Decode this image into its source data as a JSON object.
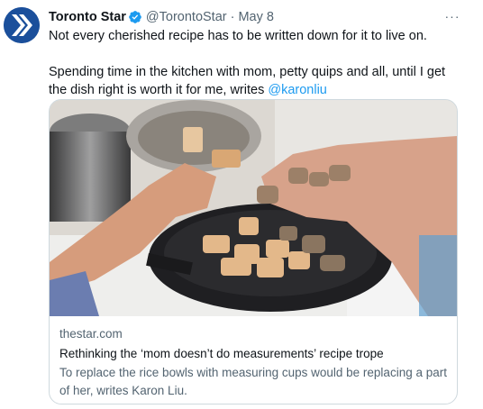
{
  "tweet": {
    "author": {
      "display_name": "Toronto Star",
      "handle": "@TorontoStar",
      "separator": "·",
      "timestamp": "May 8"
    },
    "text_line1": "Not every cherished recipe has to be written down for it to live on.",
    "text_line2": "Spending time in the kitchen with mom, petty quips and all, until I get the dish right is worth it for me, writes ",
    "mention": "@karonliu",
    "more_label": "···",
    "card": {
      "domain": "thestar.com",
      "title": "Rethinking the ‘mom doesn’t do measurements’ recipe trope",
      "description": "To replace the rice bowls with measuring cups would be replacing a part of her, writes Karon Liu."
    }
  },
  "colors": {
    "brand": "#1b4f9b",
    "link": "#1d9bf0",
    "muted_text": "#536471",
    "border": "#cfd9de"
  },
  "icons": [
    "toronto-star-logo-icon",
    "verified-badge-icon",
    "more-options-icon"
  ]
}
